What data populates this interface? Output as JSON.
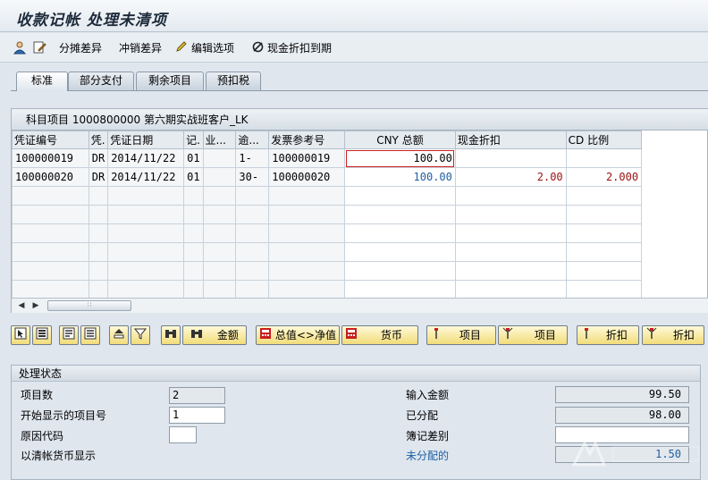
{
  "window": {
    "title": "收款记帐 处理未清项"
  },
  "toolbar": {
    "items": [
      {
        "icon": "person-icon",
        "label": ""
      },
      {
        "icon": "edit-doc-icon",
        "label": ""
      },
      {
        "icon": "",
        "label": "分摊差异"
      },
      {
        "icon": "",
        "label": "冲销差异"
      },
      {
        "icon": "pencil-icon",
        "label": "编辑选项"
      },
      {
        "icon": "no-entry-icon",
        "label": "现金折扣到期"
      }
    ]
  },
  "tabs": [
    "标准",
    "部分支付",
    "剩余项目",
    "预扣税"
  ],
  "grid": {
    "title": "科目项目 1000800000 第六期实战班客户_LK",
    "columns": [
      "凭证编号",
      "凭.",
      "凭证日期",
      "记.",
      "业...",
      "逾...",
      "发票参考号",
      "CNY 总额",
      "现金折扣",
      "CD 比例"
    ],
    "rows": [
      [
        "100000019",
        "DR",
        "2014/11/22",
        "01",
        "",
        "1-",
        "100000019",
        "100.00",
        "",
        ""
      ],
      [
        "100000020",
        "DR",
        "2014/11/22",
        "01",
        "",
        "30-",
        "100000020",
        "100.00",
        "2.00",
        "2.000"
      ]
    ]
  },
  "buttons": {
    "amount": "金额",
    "gross_net": "总值<>净值",
    "currency": "货币",
    "items": "项目",
    "items2": "项目",
    "discount": "折扣",
    "discount2": "折扣"
  },
  "status": {
    "header": "处理状态",
    "item_count_label": "项目数",
    "item_count": "2",
    "first_item_label": "开始显示的项目号",
    "first_item": "1",
    "reason_code_label": "原因代码",
    "reason_code": "",
    "clearing_currency_label": "以清帐货币显示",
    "input_amount_label": "输入金额",
    "input_amount": "99.50",
    "assigned_label": "已分配",
    "assigned": "98.00",
    "difference_label": "簿记差别",
    "difference": "",
    "unassigned_label": "未分配的",
    "unassigned": "1.50"
  },
  "colors": {
    "accent_blue": "#1f5fa0",
    "value_red": "#9a0f0f",
    "button_yellow": "#f1dc7a"
  }
}
